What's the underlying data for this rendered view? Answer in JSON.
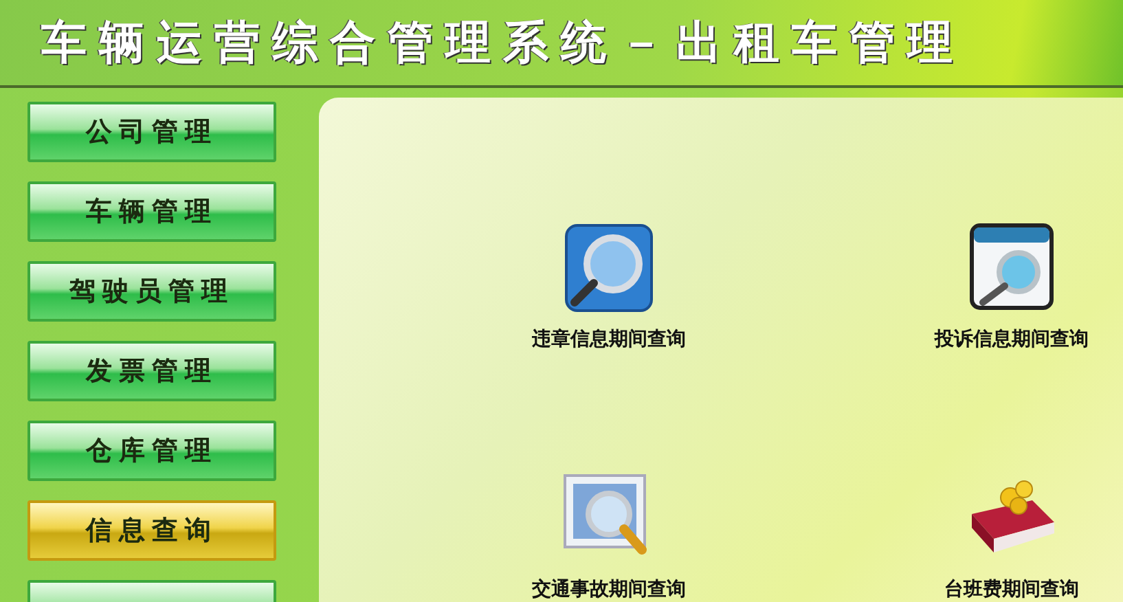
{
  "title": "车辆运营综合管理系统－出租车管理",
  "menu": [
    {
      "label": "公司管理",
      "selected": false
    },
    {
      "label": "车辆管理",
      "selected": false
    },
    {
      "label": "驾驶员管理",
      "selected": false
    },
    {
      "label": "发票管理",
      "selected": false
    },
    {
      "label": "仓库管理",
      "selected": false
    },
    {
      "label": "信息查询",
      "selected": true
    },
    {
      "selected": false
    }
  ],
  "queries": [
    {
      "label": "违章信息期间查询",
      "kind": "tile"
    },
    {
      "label": "投诉信息期间查询",
      "kind": "window"
    },
    {
      "label": "交通事故期间查询",
      "kind": "photo"
    },
    {
      "label": "台班费期间查询",
      "kind": "book"
    }
  ]
}
